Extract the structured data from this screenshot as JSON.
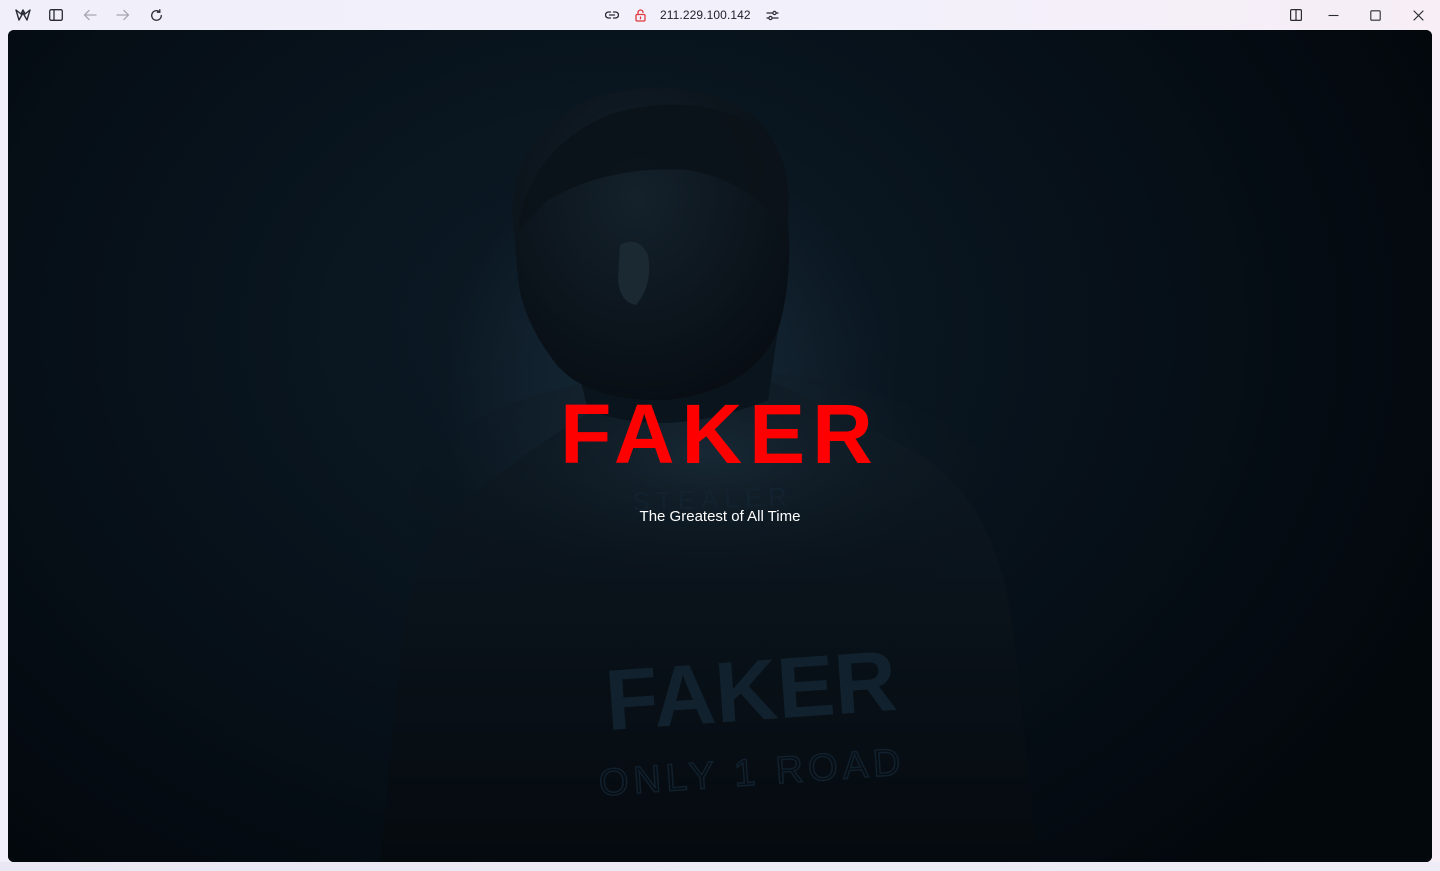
{
  "browser": {
    "url": "211.229.100.142",
    "toolbar": {
      "app_icon": "app-logo-icon",
      "sidebar_icon": "sidebar-toggle-icon",
      "back_icon": "arrow-left-icon",
      "forward_icon": "arrow-right-icon",
      "reload_icon": "reload-icon",
      "link_icon": "link-icon",
      "security_icon": "lock-open-icon",
      "site_settings_icon": "sliders-icon",
      "split_view_icon": "split-view-icon",
      "minimize_icon": "minimize-icon",
      "maximize_icon": "maximize-icon",
      "close_icon": "close-icon"
    },
    "colors": {
      "security_warning": "#e0393e"
    }
  },
  "hero": {
    "title": "FAKER",
    "subtitle": "The Greatest of All Time",
    "jersey_text_top": "STEALER",
    "jersey_text_main": "FAKER",
    "jersey_text_bottom": "ONLY 1 ROAD",
    "title_color": "#ff0000",
    "subtitle_color": "#ffffff"
  }
}
